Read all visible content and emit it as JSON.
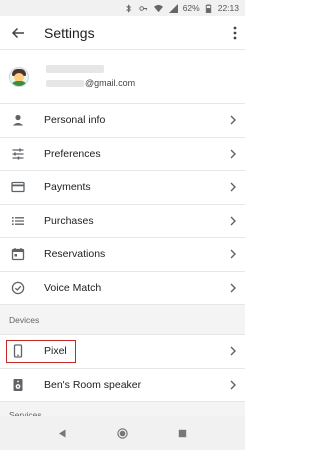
{
  "status_bar": {
    "battery_percent": "62%",
    "time": "22:13",
    "icons": [
      "bluetooth-icon",
      "key-icon",
      "wifi-icon",
      "signal-icon",
      "battery-icon"
    ]
  },
  "app_bar": {
    "title": "Settings",
    "back_icon": "arrow-back-icon",
    "more_icon": "more-vert-icon"
  },
  "account": {
    "email_suffix": "@gmail.com"
  },
  "menu_items": [
    {
      "label": "Personal info",
      "icon": "person-icon"
    },
    {
      "label": "Preferences",
      "icon": "sliders-icon"
    },
    {
      "label": "Payments",
      "icon": "credit-card-icon"
    },
    {
      "label": "Purchases",
      "icon": "list-icon"
    },
    {
      "label": "Reservations",
      "icon": "calendar-icon"
    },
    {
      "label": "Voice Match",
      "icon": "check-circle-icon"
    }
  ],
  "devices_section": {
    "header": "Devices",
    "items": [
      {
        "label": "Pixel",
        "icon": "phone-icon",
        "highlighted": true
      },
      {
        "label": "Ben's Room speaker",
        "icon": "speaker-icon",
        "highlighted": false
      }
    ]
  },
  "services_section": {
    "header": "Services"
  },
  "nav_bar": {
    "icons": [
      "back-triangle-icon",
      "home-circle-icon",
      "recents-square-icon"
    ]
  },
  "colors": {
    "highlight": "#c62828",
    "section_bg": "#f4f4f4",
    "divider": "#e6e6e6",
    "icon": "#5f6368"
  }
}
